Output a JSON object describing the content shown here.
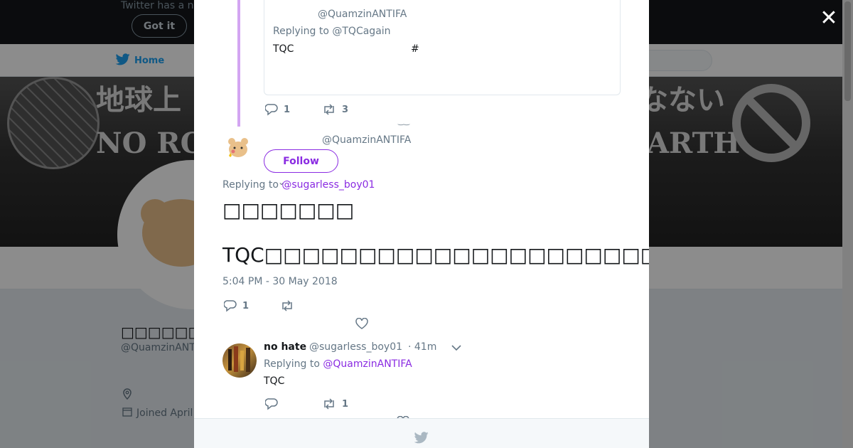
{
  "background": {
    "notice_text": "Twitter has a n",
    "got_it_label": "Got it",
    "nav_home_label": "Home",
    "profile_name": "□□□□□□□□□",
    "profile_handle": "@QuamzinANT",
    "joined_text": "Joined April",
    "header_text_left": "地球上",
    "header_text_left2": "NO RO",
    "header_text_right": "なない",
    "header_text_right2": "ARTH"
  },
  "overlay": {
    "close_icon": "close-icon",
    "close_glyph": "✕"
  },
  "quoted_tweet": {
    "handle": "@QuamzinANTIFA",
    "replying_to": "Replying to @TQCagain",
    "text": "TQC",
    "hash": "#",
    "reply_count": "1",
    "retweet_count": "3"
  },
  "main_tweet": {
    "handle": "@QuamzinANTIFA",
    "follow_label": "Follow",
    "replying_prefix": "Replying to ",
    "replying_user": "@sugarless_boy01",
    "text_line1": "□□□□□□□",
    "text_line2": "TQC□□□□□□□□□□□□□□□□□□□□□□□□□□□□□□□□□□□",
    "timestamp": "5:04 PM - 30 May 2018",
    "reply_count": "1",
    "retweet_count": "",
    "like_count": ""
  },
  "reply_tweet": {
    "name": "no hate",
    "handle": "@sugarless_boy01",
    "time": "· 41m",
    "replying_prefix": "Replying to ",
    "replying_user": "@QuamzinANTIFA",
    "text": "TQC",
    "reply_count": "",
    "retweet_count": "1",
    "like_count": ""
  },
  "colors": {
    "accent": "#8a2be2",
    "thread_line": "#d3a5f2",
    "twitter_blue": "#1da1f2",
    "muted": "#657786"
  }
}
